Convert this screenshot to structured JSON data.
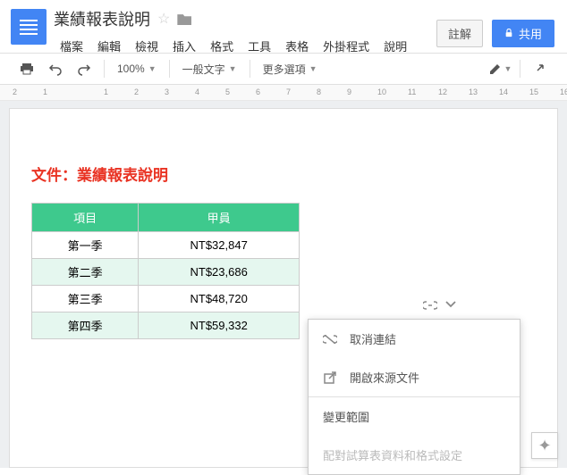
{
  "header": {
    "title": "業績報表說明",
    "menu": [
      "檔案",
      "編輯",
      "檢視",
      "插入",
      "格式",
      "工具",
      "表格",
      "外掛程式",
      "說明"
    ],
    "comment_btn": "註解",
    "share_btn": "共用"
  },
  "toolbar": {
    "zoom": "100%",
    "style": "一般文字",
    "more": "更多選項"
  },
  "ruler_numbers": [
    "2",
    "1",
    "",
    "1",
    "2",
    "3",
    "4",
    "5",
    "6",
    "7",
    "8",
    "9",
    "10",
    "11",
    "12",
    "13",
    "14",
    "15",
    "16"
  ],
  "document": {
    "heading": "文件：業績報表說明",
    "table": {
      "headers": [
        "項目",
        "甲員"
      ],
      "rows": [
        {
          "label": "第一季",
          "value": "NT$32,847"
        },
        {
          "label": "第二季",
          "value": "NT$23,686"
        },
        {
          "label": "第三季",
          "value": "NT$48,720"
        },
        {
          "label": "第四季",
          "value": "NT$59,332"
        }
      ]
    }
  },
  "popup": {
    "cancel_link": "取消連結",
    "open_source": "開啟來源文件",
    "change_range": "變更範圍",
    "match_format": "配對試算表資料和格式設定"
  }
}
